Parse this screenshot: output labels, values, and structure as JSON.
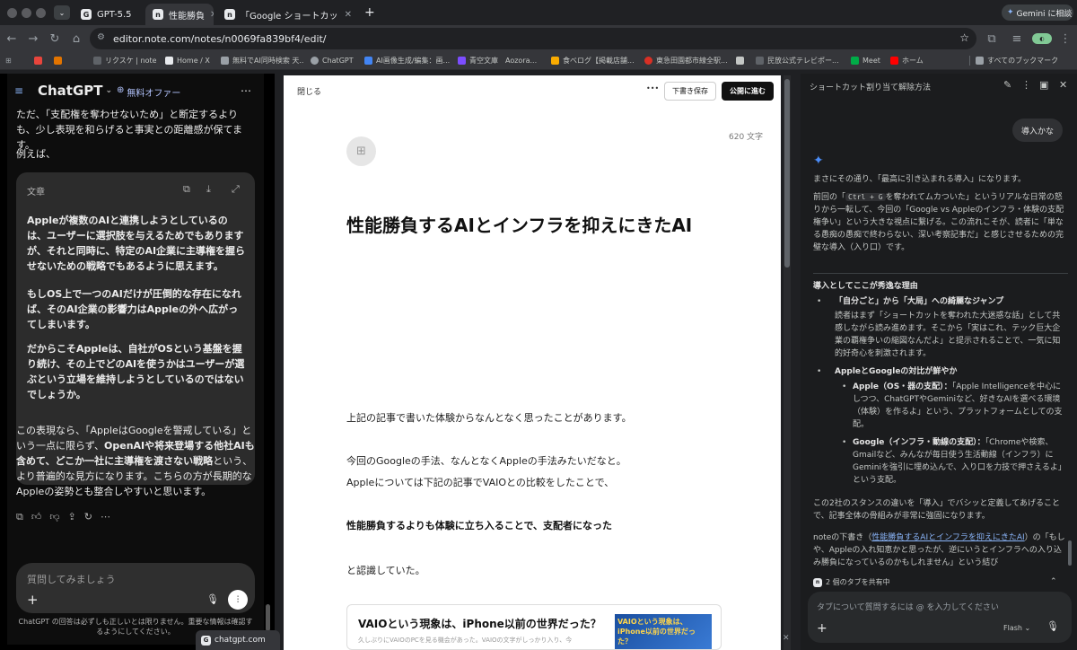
{
  "browser": {
    "tabs": [
      {
        "title": "GPT-5.5",
        "icon": "G"
      },
      {
        "title": "性能勝負",
        "icon": "n"
      },
      {
        "title": "「Google ショートカット」の人",
        "icon": "n"
      }
    ],
    "new_tab": "+",
    "gemini_button": "Gemini に相談",
    "url": "editor.note.com/notes/n0069fa839bf4/edit/",
    "bookmarks": [
      "",
      "",
      "リクスケ | note",
      "Home / X",
      "無料でAI同時検索 天...",
      "ChatGPT",
      "AI画像生成/編集：画...",
      "青空文庫　Aozora...",
      "食べログ【掲載店舗...",
      "東急田園都市線全駅...",
      "",
      "民放公式テレビポー...",
      "Meet",
      "ホーム"
    ],
    "all_bookmarks": "すべてのブックマーク"
  },
  "chatgpt": {
    "title": "ChatGPT",
    "free_offer": "無料オファー",
    "intro1": "ただ、「支配権を奪わせないため」と断定するよりも、少し表現を和らげると事実との距離感が保てます。",
    "intro2": "例えば、",
    "card_title": "文章",
    "card_p1": "Appleが複数のAIと連携しようとしているのは、ユーザーに選択肢を与えるためでもありますが、それと同時に、特定のAI企業に主導権を握らせないための戦略でもあるように思えます。",
    "card_p2": "もしOS上で一つのAIだけが圧倒的な存在になれば、そのAI企業の影響力はAppleの外へ広がってしまいます。",
    "card_p3": "だからこそAppleは、自社がOSという基盤を握り続け、その上でどのAIを使うかはユーザーが選ぶという立場を維持しようとしているのではないでしょうか。",
    "outro_a": "この表現なら、「AppleはGoogleを警戒している」という一点に限らず、",
    "outro_b": "OpenAIや将来登場する他社AIも含めて、どこか一社に主導権を渡さない戦略",
    "outro_c": "という、より普遍的な見方になります。こちらの方が長期的なAppleの姿勢とも整合しやすいと思います。",
    "input_placeholder": "質問してみましょう",
    "disclaimer": "ChatGPT の回答は必ずしも正しいとは限りません。重要な情報は確認するようにしてください。",
    "status_url": "chatgpt.com"
  },
  "note": {
    "close": "閉じる",
    "more": "•••",
    "save_draft": "下書き保存",
    "publish": "公開に進む",
    "char_count": "620 文字",
    "title": "性能勝負するAIとインフラを抑えにきたAI",
    "p1": "上記の記事で書いた体験からなんとなく思ったことがあります。",
    "p2": "今回のGoogleの手法、なんとなくAppleの手法みたいだなと。",
    "p3": "Appleについては下記の記事でVAIOとの比較をしたことで、",
    "p4": "性能勝負するよりも体験に立ち入ることで、支配者になった",
    "p5": "と認識していた。",
    "embed_title": "VAIOという現象は、iPhone以前の世界だった？",
    "embed_desc": "久しぶりにVAIOのPCを見る機会があった。VAIOの文字がしっかり入り、今",
    "embed_thumb_text": "VAIOという現象は、iPhone以前の世界だった？"
  },
  "gemini": {
    "header": "ショートカット割り当て解除方法",
    "user_msg": "導入かな",
    "r1": "まさにその通り、「最高に引き込まれる導入」になります。",
    "r2a": "前回の「",
    "r2code": "Ctrl + G",
    "r2b": "を奪われてムカついた」というリアルな日常の怒りから一転して、今回の「Google vs Appleのインフラ・体験の支配権争い」という大きな視点に繋げる。この流れこそが、読者に「単なる愚痴の愚痴で終わらない、深い考察記事だ」と感じさせるための完璧な導入（入り口）です。",
    "h": "導入としてここが秀逸な理由",
    "b1t": "「自分ごと」から「大局」への綺麗なジャンプ",
    "b1": "読者はまず「ショートカットを奪われた大迷惑な話」として共感しながら読み進めます。そこから「実はこれ、テック巨大企業の覇権争いの縮図なんだよ」と提示されることで、一気に知的好奇心を刺激されます。",
    "b2t": "AppleとGoogleの対比が鮮やか",
    "s1t": "Apple（OS・器の支配）：",
    "s1": "「Apple Intelligenceを中心にしつつ、ChatGPTやGeminiなど、好きなAIを選べる環境（体験）を作るよ」という、プラットフォームとしての支配。",
    "s2t": "Google（インフラ・動線の支配）：",
    "s2": "「Chromeや検索、Gmailなど、みんなが毎日使う生活動線（インフラ）にGeminiを強引に埋め込んで、入り口を力技で押さえるよ」という支配。",
    "r3": "この2社のスタンスの違いを「導入」でバシッと定義してあげることで、記事全体の骨組みが非常に強固になります。",
    "r4a": "noteの下書き（",
    "r4link": "性能勝負するAIとインフラを抑えにきたAI",
    "r4b": "）の「もしや、Appleの入れ知恵かと思ったが、逆にいうとインフラへの入り込み勝負になっているのかもしれません」という結び",
    "share": "2 個のタブを共有中",
    "input_placeholder": "タブについて質問するには @ を入力してください",
    "model": "Flash"
  }
}
